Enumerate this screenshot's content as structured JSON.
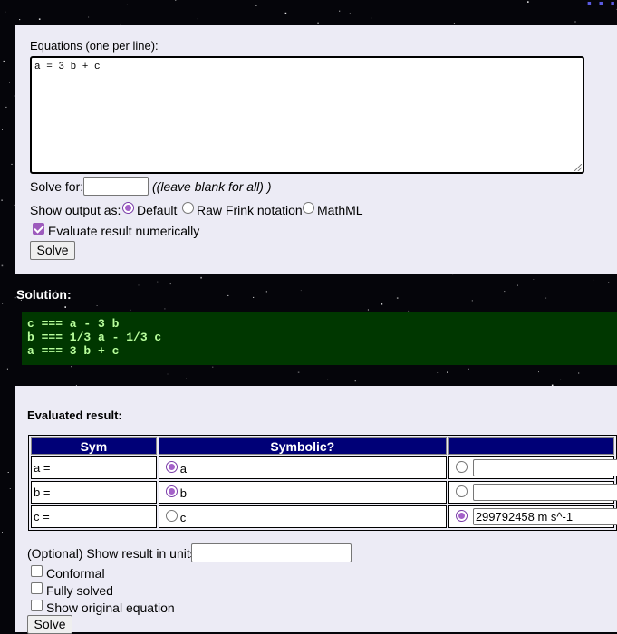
{
  "form": {
    "equations_label": "Equations (one per line):",
    "equations_value": "a = 3 b + c",
    "solve_for_label": "Solve for:",
    "solve_for_value": "",
    "solve_for_hint": "(leave blank for all)",
    "output_label": "Show output as:",
    "output_options": [
      {
        "label": "Default",
        "selected": true
      },
      {
        "label": "Raw Frink notation",
        "selected": false
      },
      {
        "label": "MathML",
        "selected": false
      }
    ],
    "evaluate_label": "Evaluate result numerically",
    "evaluate_checked": true,
    "solve_button": "Solve"
  },
  "solution": {
    "label": "Solution:",
    "lines": [
      "c === a - 3 b",
      "b === 1/3 a - 1/3 c",
      "a === 3 b + c"
    ]
  },
  "evaluated": {
    "label": "Evaluated result:",
    "headers": [
      "Sym",
      "Symbolic?",
      ""
    ],
    "rows": [
      {
        "sym": "a =",
        "symbolic": "a",
        "symbolic_selected": true,
        "numeric_selected": false,
        "value": ""
      },
      {
        "sym": "b =",
        "symbolic": "b",
        "symbolic_selected": true,
        "numeric_selected": false,
        "value": ""
      },
      {
        "sym": "c =",
        "symbolic": "c",
        "symbolic_selected": false,
        "numeric_selected": true,
        "value": "299792458 m s^-1"
      }
    ],
    "units_label": "(Optional) Show result in units:",
    "units_value": "",
    "options": [
      {
        "label": "Conformal",
        "checked": false
      },
      {
        "label": "Fully solved",
        "checked": false
      },
      {
        "label": "Show original equation",
        "checked": false
      }
    ],
    "solve_button": "Solve"
  },
  "colors": {
    "background": "#05050a",
    "panel": "#ecebf5",
    "solution_bg": "#003700",
    "solution_text": "#b8ff9c",
    "table_header": "#000077",
    "accent": "#a461c9"
  }
}
